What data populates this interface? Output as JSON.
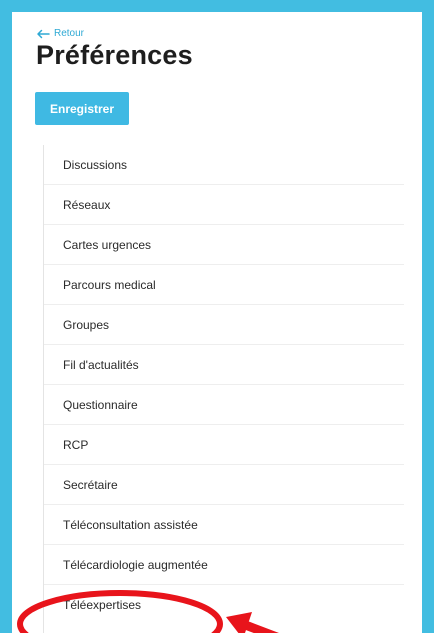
{
  "header": {
    "back_label": "Retour",
    "title": "Préférences",
    "save_label": "Enregistrer"
  },
  "menu": {
    "items": [
      {
        "label": "Discussions"
      },
      {
        "label": "Réseaux"
      },
      {
        "label": "Cartes urgences"
      },
      {
        "label": "Parcours medical"
      },
      {
        "label": "Groupes"
      },
      {
        "label": "Fil d'actualités"
      },
      {
        "label": "Questionnaire"
      },
      {
        "label": "RCP"
      },
      {
        "label": "Secrétaire"
      },
      {
        "label": "Téléconsultation assistée"
      },
      {
        "label": "Télécardiologie augmentée"
      },
      {
        "label": "Téléexpertises"
      }
    ]
  },
  "colors": {
    "accent": "#42bde1",
    "annotation": "#e8141b"
  }
}
